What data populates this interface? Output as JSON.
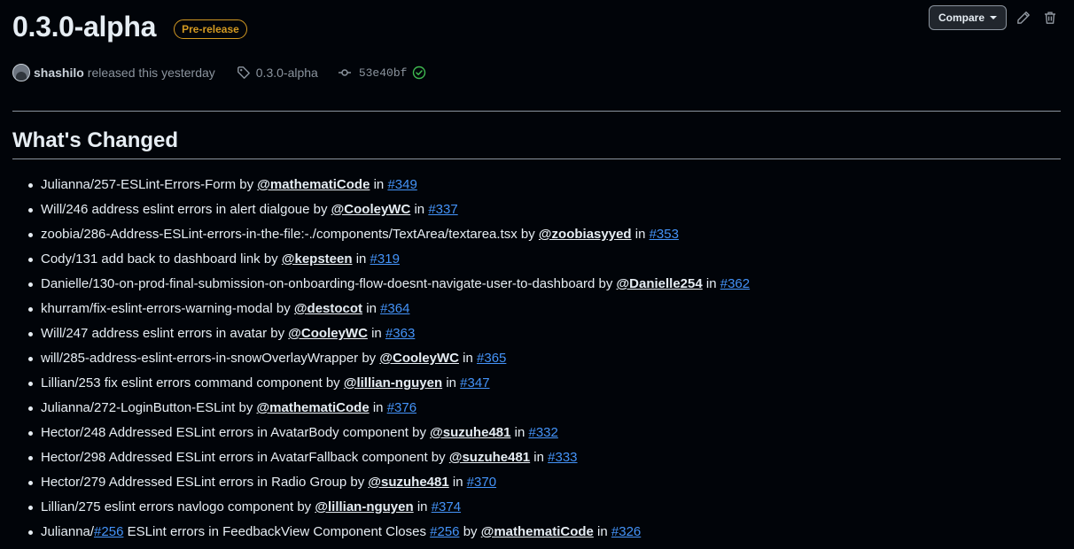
{
  "release": {
    "title": "0.3.0-alpha",
    "badge": "Pre-release",
    "author": "shashilo",
    "released_text": "released this yesterday",
    "tag": "0.3.0-alpha",
    "commit": "53e40bf"
  },
  "actions": {
    "compare_label": "Compare",
    "edit_icon": "pencil-icon",
    "delete_icon": "trash-icon"
  },
  "section": {
    "heading": "What's Changed"
  },
  "changes": [
    {
      "parts": [
        {
          "t": "text",
          "v": "Julianna/257-ESLint-Errors-Form by "
        },
        {
          "t": "user",
          "v": "@mathematiCode"
        },
        {
          "t": "text",
          "v": " in "
        },
        {
          "t": "pr",
          "v": "#349"
        }
      ]
    },
    {
      "parts": [
        {
          "t": "text",
          "v": "Will/246 address eslint errors in alert dialgoue by "
        },
        {
          "t": "user",
          "v": "@CooleyWC"
        },
        {
          "t": "text",
          "v": " in "
        },
        {
          "t": "pr",
          "v": "#337"
        }
      ]
    },
    {
      "parts": [
        {
          "t": "text",
          "v": "zoobia/286-Address-ESLint-errors-in-the-file:-./components/TextArea/textarea.tsx by "
        },
        {
          "t": "user",
          "v": "@zoobiasyyed"
        },
        {
          "t": "text",
          "v": " in "
        },
        {
          "t": "pr",
          "v": "#353"
        }
      ]
    },
    {
      "parts": [
        {
          "t": "text",
          "v": "Cody/131 add back to dashboard link by "
        },
        {
          "t": "user",
          "v": "@kepsteen"
        },
        {
          "t": "text",
          "v": " in "
        },
        {
          "t": "pr",
          "v": "#319"
        }
      ]
    },
    {
      "parts": [
        {
          "t": "text",
          "v": "Danielle/130-on-prod-final-submission-on-onboarding-flow-doesnt-navigate-user-to-dashboard by "
        },
        {
          "t": "user",
          "v": "@Danielle254"
        },
        {
          "t": "text",
          "v": " in "
        },
        {
          "t": "pr",
          "v": "#362"
        }
      ]
    },
    {
      "parts": [
        {
          "t": "text",
          "v": "khurram/fix-eslint-errors-warning-modal by "
        },
        {
          "t": "user",
          "v": "@destocot"
        },
        {
          "t": "text",
          "v": " in "
        },
        {
          "t": "pr",
          "v": "#364"
        }
      ]
    },
    {
      "parts": [
        {
          "t": "text",
          "v": "Will/247 address eslint errors in avatar by "
        },
        {
          "t": "user",
          "v": "@CooleyWC"
        },
        {
          "t": "text",
          "v": " in "
        },
        {
          "t": "pr",
          "v": "#363"
        }
      ]
    },
    {
      "parts": [
        {
          "t": "text",
          "v": "will/285-address-eslint-errors-in-snowOverlayWrapper by "
        },
        {
          "t": "user",
          "v": "@CooleyWC"
        },
        {
          "t": "text",
          "v": " in "
        },
        {
          "t": "pr",
          "v": "#365"
        }
      ]
    },
    {
      "parts": [
        {
          "t": "text",
          "v": "Lillian/253 fix eslint errors command component by "
        },
        {
          "t": "user",
          "v": "@lillian-nguyen"
        },
        {
          "t": "text",
          "v": " in "
        },
        {
          "t": "pr",
          "v": "#347"
        }
      ]
    },
    {
      "parts": [
        {
          "t": "text",
          "v": "Julianna/272-LoginButton-ESLint by "
        },
        {
          "t": "user",
          "v": "@mathematiCode"
        },
        {
          "t": "text",
          "v": " in "
        },
        {
          "t": "pr",
          "v": "#376"
        }
      ]
    },
    {
      "parts": [
        {
          "t": "text",
          "v": "Hector/248 Addressed ESLint errors in AvatarBody component by "
        },
        {
          "t": "user",
          "v": "@suzuhe481"
        },
        {
          "t": "text",
          "v": " in "
        },
        {
          "t": "pr",
          "v": "#332"
        }
      ]
    },
    {
      "parts": [
        {
          "t": "text",
          "v": "Hector/298 Addressed ESLint errors in AvatarFallback component by "
        },
        {
          "t": "user",
          "v": "@suzuhe481"
        },
        {
          "t": "text",
          "v": " in "
        },
        {
          "t": "pr",
          "v": "#333"
        }
      ]
    },
    {
      "parts": [
        {
          "t": "text",
          "v": "Hector/279 Addressed ESLint errors in Radio Group by "
        },
        {
          "t": "user",
          "v": "@suzuhe481"
        },
        {
          "t": "text",
          "v": " in "
        },
        {
          "t": "pr",
          "v": "#370"
        }
      ]
    },
    {
      "parts": [
        {
          "t": "text",
          "v": "Lillian/275 eslint errors navlogo component by "
        },
        {
          "t": "user",
          "v": "@lillian-nguyen"
        },
        {
          "t": "text",
          "v": " in "
        },
        {
          "t": "pr",
          "v": "#374"
        }
      ]
    },
    {
      "parts": [
        {
          "t": "text",
          "v": "Julianna/"
        },
        {
          "t": "pr",
          "v": "#256"
        },
        {
          "t": "text",
          "v": " ESLint errors in FeedbackView Component Closes "
        },
        {
          "t": "pr",
          "v": "#256"
        },
        {
          "t": "text",
          "v": " by "
        },
        {
          "t": "user",
          "v": "@mathematiCode"
        },
        {
          "t": "text",
          "v": " in "
        },
        {
          "t": "pr",
          "v": "#326"
        }
      ]
    }
  ]
}
